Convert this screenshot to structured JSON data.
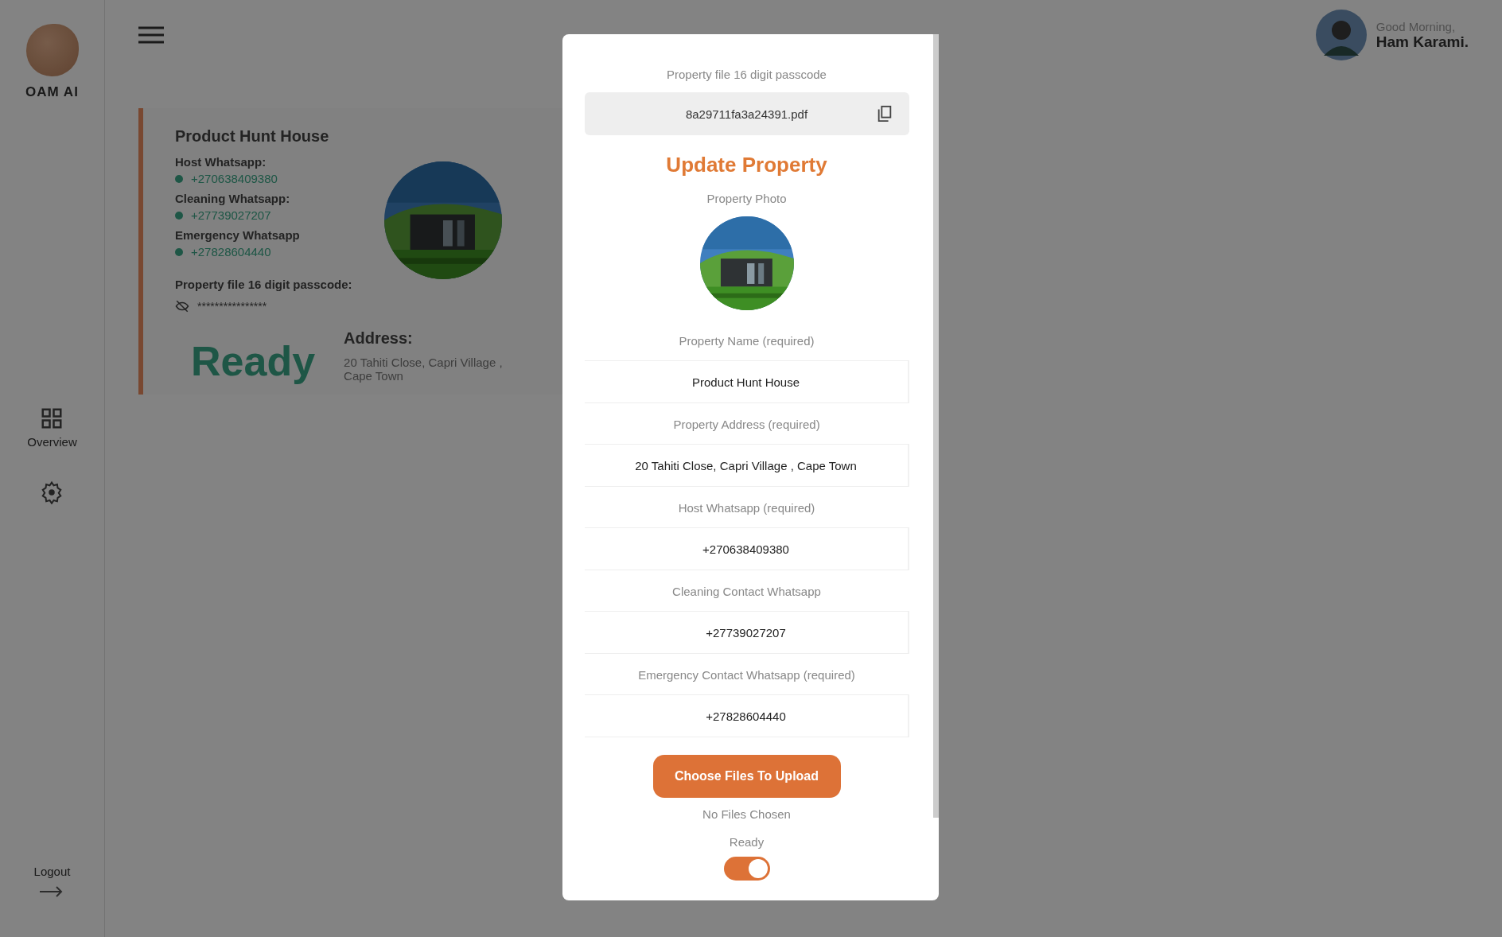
{
  "sidebar": {
    "logo_text": "OAM AI",
    "overview_label": "Overview",
    "logout_label": "Logout"
  },
  "header": {
    "greeting": "Good Morning,",
    "user_name": "Ham Karami."
  },
  "property_card": {
    "name": "Product Hunt House",
    "contacts": [
      {
        "label": "Host Whatsapp:",
        "number": "+270638409380"
      },
      {
        "label": "Cleaning Whatsapp:",
        "number": "+27739027207"
      },
      {
        "label": "Emergency Whatsapp",
        "number": "+27828604440"
      }
    ],
    "passcode_label": "Property file 16 digit passcode:",
    "passcode_masked": "****************",
    "status": "Ready",
    "address_label": "Address:",
    "address": "20 Tahiti Close, Capri Village , Cape Town"
  },
  "modal": {
    "passcode_label": "Property file 16 digit passcode",
    "file_name": "8a29711fa3a24391.pdf",
    "title": "Update Property",
    "photo_label": "Property Photo",
    "fields": [
      {
        "label": "Property Name (required)",
        "value": "Product Hunt House"
      },
      {
        "label": "Property Address (required)",
        "value": "20 Tahiti Close, Capri Village , Cape Town"
      },
      {
        "label": "Host Whatsapp (required)",
        "value": "+270638409380"
      },
      {
        "label": "Cleaning Contact Whatsapp",
        "value": "+27739027207"
      },
      {
        "label": "Emergency Contact Whatsapp (required)",
        "value": "+27828604440"
      }
    ],
    "upload_button": "Choose Files To Upload",
    "upload_status": "No Files Chosen",
    "ready_label": "Ready",
    "ready_on": true
  }
}
